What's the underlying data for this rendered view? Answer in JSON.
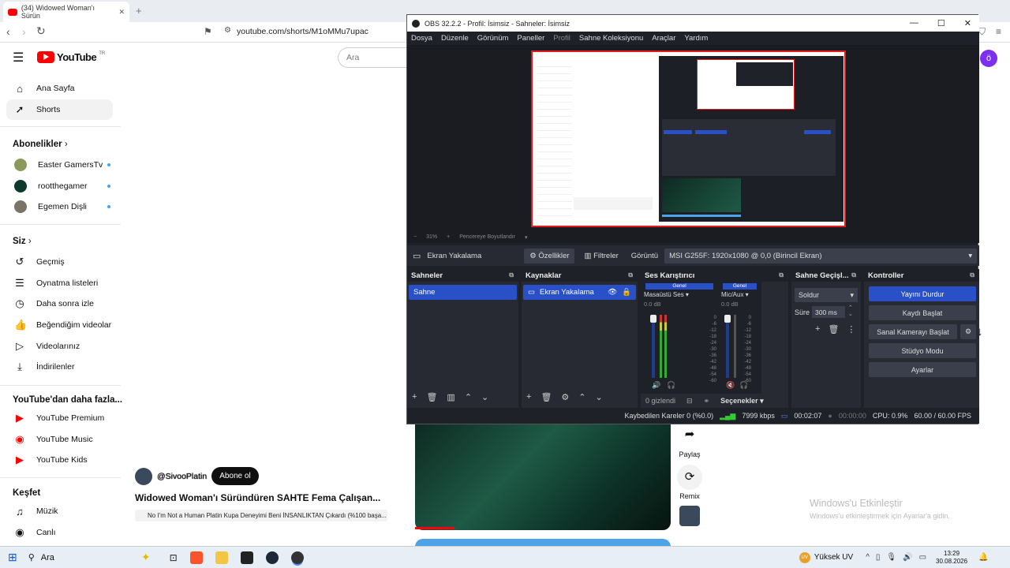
{
  "browser": {
    "tab_title": "(34) Widowed Woman'ı Sürün",
    "url": "youtube.com/shorts/M1oMMu7upac"
  },
  "youtube": {
    "logo": "YouTube",
    "logo_region": "TR",
    "search_placeholder": "Ara",
    "nav": [
      {
        "label": "Ana Sayfa",
        "icon": "home-icon"
      },
      {
        "label": "Shorts",
        "icon": "shorts-icon"
      }
    ],
    "subs_heading": "Abonelikler",
    "subs": [
      {
        "label": "Easter GamersTv"
      },
      {
        "label": "rootthegamer"
      },
      {
        "label": "Egemen Dişli"
      }
    ],
    "you_heading": "Siz",
    "you_items": [
      {
        "label": "Geçmiş",
        "icon": "history-icon"
      },
      {
        "label": "Oynatma listeleri",
        "icon": "playlist-icon"
      },
      {
        "label": "Daha sonra izle",
        "icon": "clock-icon"
      },
      {
        "label": "Beğendiğim videolar",
        "icon": "thumbs-up-icon"
      },
      {
        "label": "Videolarınız",
        "icon": "video-icon"
      },
      {
        "label": "İndirilenler",
        "icon": "download-icon"
      }
    ],
    "more_heading": "YouTube'dan daha fazla...",
    "more_items": [
      {
        "label": "YouTube Premium"
      },
      {
        "label": "YouTube Music"
      },
      {
        "label": "YouTube Kids"
      }
    ],
    "explore_heading": "Keşfet",
    "explore_items": [
      {
        "label": "Müzik",
        "icon": "music-icon"
      },
      {
        "label": "Canlı",
        "icon": "live-icon"
      }
    ],
    "channel": "@SivooPlatin",
    "subscribe": "Abone ol",
    "video_title": "Widowed Woman'ı Süründüren SAHTE Fema Çalışan...",
    "music_chip": "No I'm Not a Human Platin Kupa Deneyimi Beni İNSANLIKTAN Çıkardı (%100 başa...",
    "share": "Paylaş",
    "remix": "Remix"
  },
  "obs": {
    "title": "OBS 32.2.2 - Profil: İsimsiz - Sahneler: İsimsiz",
    "menu": [
      "Dosya",
      "Düzenle",
      "Görünüm",
      "Paneller",
      "Profil",
      "Sahne Koleksiyonu",
      "Araçlar",
      "Yardım"
    ],
    "zoom": "31%",
    "fit": "Pencereye Boyutlandır",
    "source_name": "Ekran Yakalama",
    "props_btn": "Özellikler",
    "filters_btn": "Filtreler",
    "display_label": "Görüntü",
    "display_value": "MSI G255F: 1920x1080 @ 0,0 (Birincil Ekran)",
    "scenes_title": "Sahneler",
    "scene_item": "Sahne",
    "sources_title": "Kaynaklar",
    "source_item": "Ekran Yakalama",
    "mixer_title": "Ses Karıştırıcı",
    "mixer_tag": "Genel",
    "ch1": "Masaüstü Ses",
    "ch2": "Mic/Aux",
    "db1": "0.0 dB",
    "db2": "0.0 dB",
    "ticks": [
      "0",
      "-6",
      "-12",
      "-18",
      "-24",
      "-30",
      "-36",
      "-42",
      "-48",
      "-54",
      "-60"
    ],
    "hidden": "0 gizlendi",
    "options": "Seçenekler",
    "trans_title": "Sahne Geçişl...",
    "trans_value": "Soldur",
    "duration_label": "Süre",
    "duration_value": "300 ms",
    "controls_title": "Kontroller",
    "controls": [
      "Yayını Durdur",
      "Kaydı Başlat",
      "Sanal Kamerayı Başlat",
      "Stüdyo Modu",
      "Ayarlar"
    ],
    "status": {
      "dropped": "Kaybedilen Kareler 0 (%0.0)",
      "kbps": "7999 kbps",
      "stream_time": "00:02:07",
      "rec_time": "00:00:00",
      "cpu": "CPU: 0.9%",
      "fps": "60.00 / 60.00 FPS"
    }
  },
  "windows": {
    "activate_title": "Windows'u Etkinleştir",
    "activate_sub": "Windows'u etkinleştirmek için Ayarlar'a gidin.",
    "search": "Ara",
    "uv": "Yüksek UV",
    "time": "13:29",
    "date": "30.08.2026"
  },
  "colors": {
    "yt_red": "#ff0000",
    "obs_blue": "#2a50c8",
    "obs_bg": "#1f2129",
    "obs_panel": "#272a33"
  }
}
